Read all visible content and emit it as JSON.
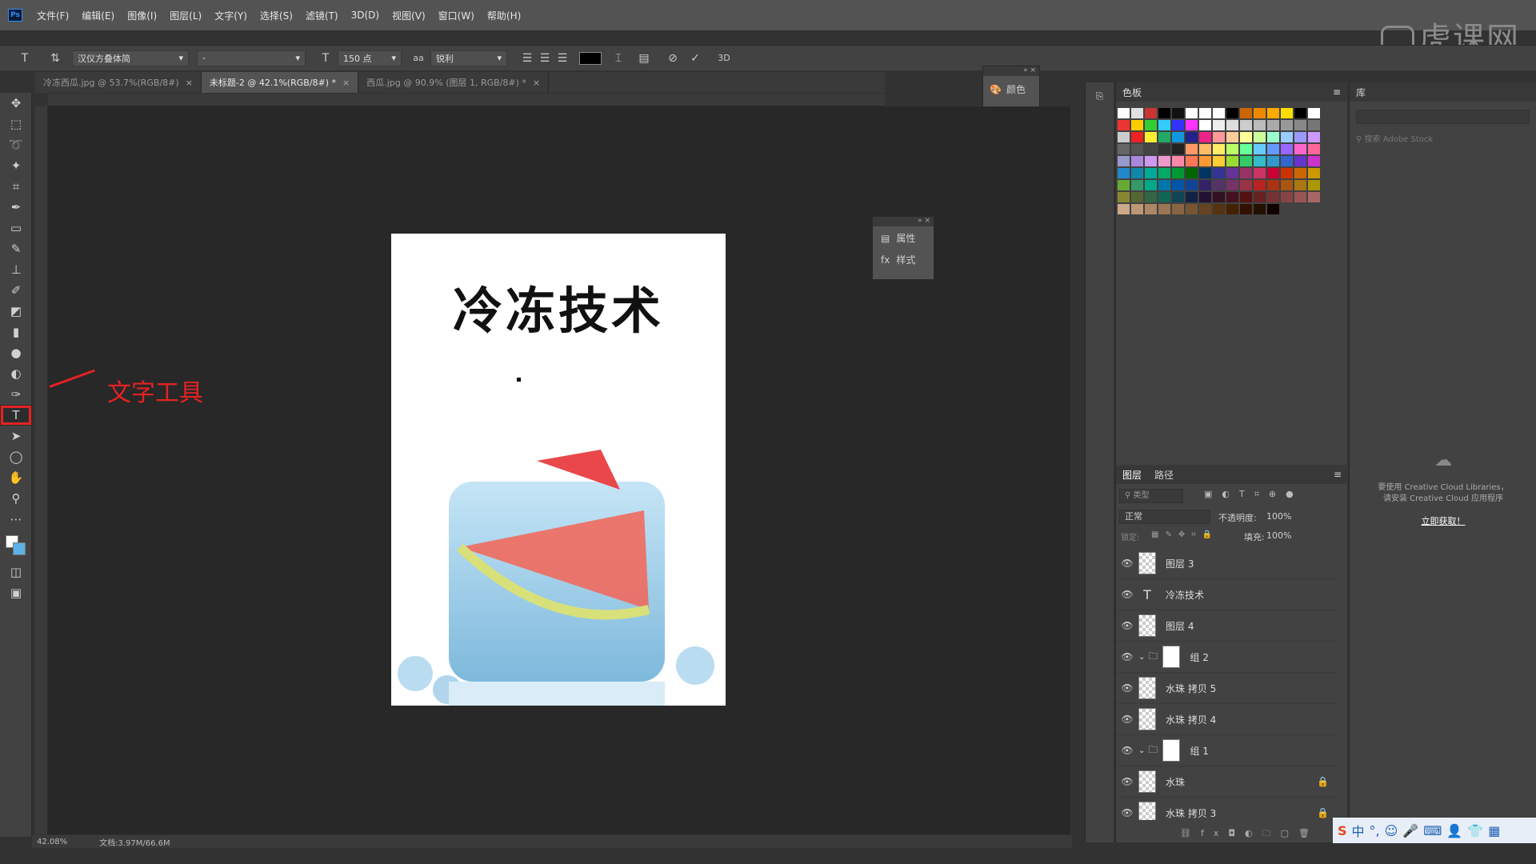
{
  "menubar": {
    "logo": "Ps",
    "items": [
      "文件(F)",
      "编辑(E)",
      "图像(I)",
      "图层(L)",
      "文字(Y)",
      "选择(S)",
      "滤镜(T)",
      "3D(D)",
      "视图(V)",
      "窗口(W)",
      "帮助(H)"
    ]
  },
  "watermark": "虎课网",
  "options": {
    "font_family": "汉仪方叠体简",
    "font_style": "-",
    "font_size": "150 点",
    "aa_label": "aa",
    "antialias": "锐利",
    "text_color": "#000000",
    "commit_label": "3D"
  },
  "tabs": [
    {
      "label": "冷冻西瓜.jpg @ 53.7%(RGB/8#)"
    },
    {
      "label": "未标题-2 @ 42.1%(RGB/8#) *"
    },
    {
      "label": "西瓜.jpg @ 90.9% (图层 1, RGB/8#) *"
    }
  ],
  "canvas": {
    "title": "冷冻技术"
  },
  "annotation": "文字工具",
  "status": {
    "zoom": "42.08%",
    "doc": "文档:3.97M/66.6M"
  },
  "float_color": {
    "label": "颜色"
  },
  "float_props": {
    "props_label": "属性",
    "style_label": "样式"
  },
  "swatches": {
    "title": "色板"
  },
  "layers_panel": {
    "tab_layers": "图层",
    "tab_paths": "路径",
    "filter_placeholder": "类型",
    "blend_mode": "正常",
    "opacity_label": "不透明度:",
    "opacity_value": "100%",
    "lock_label": "锁定:",
    "fill_label": "填充:",
    "fill_value": "100%",
    "layers": [
      {
        "name": "图层 3",
        "type": "raster"
      },
      {
        "name": "冷冻技术",
        "type": "text"
      },
      {
        "name": "图层 4",
        "type": "raster"
      },
      {
        "name": "组 2",
        "type": "group"
      },
      {
        "name": "水珠 拷贝 5",
        "type": "raster"
      },
      {
        "name": "水珠 拷贝 4",
        "type": "raster"
      },
      {
        "name": "组 1",
        "type": "group"
      },
      {
        "name": "水珠",
        "type": "raster"
      },
      {
        "name": "水珠 拷贝 3",
        "type": "raster"
      }
    ]
  },
  "libraries": {
    "title": "库",
    "search_placeholder": "搜索 Adobe Stock",
    "msg_line1": "要使用 Creative Cloud Libraries，",
    "msg_line2": "请安装 Creative Cloud 应用程序",
    "install_link": "立即获取！"
  },
  "taskbar": {
    "ime": "中"
  }
}
